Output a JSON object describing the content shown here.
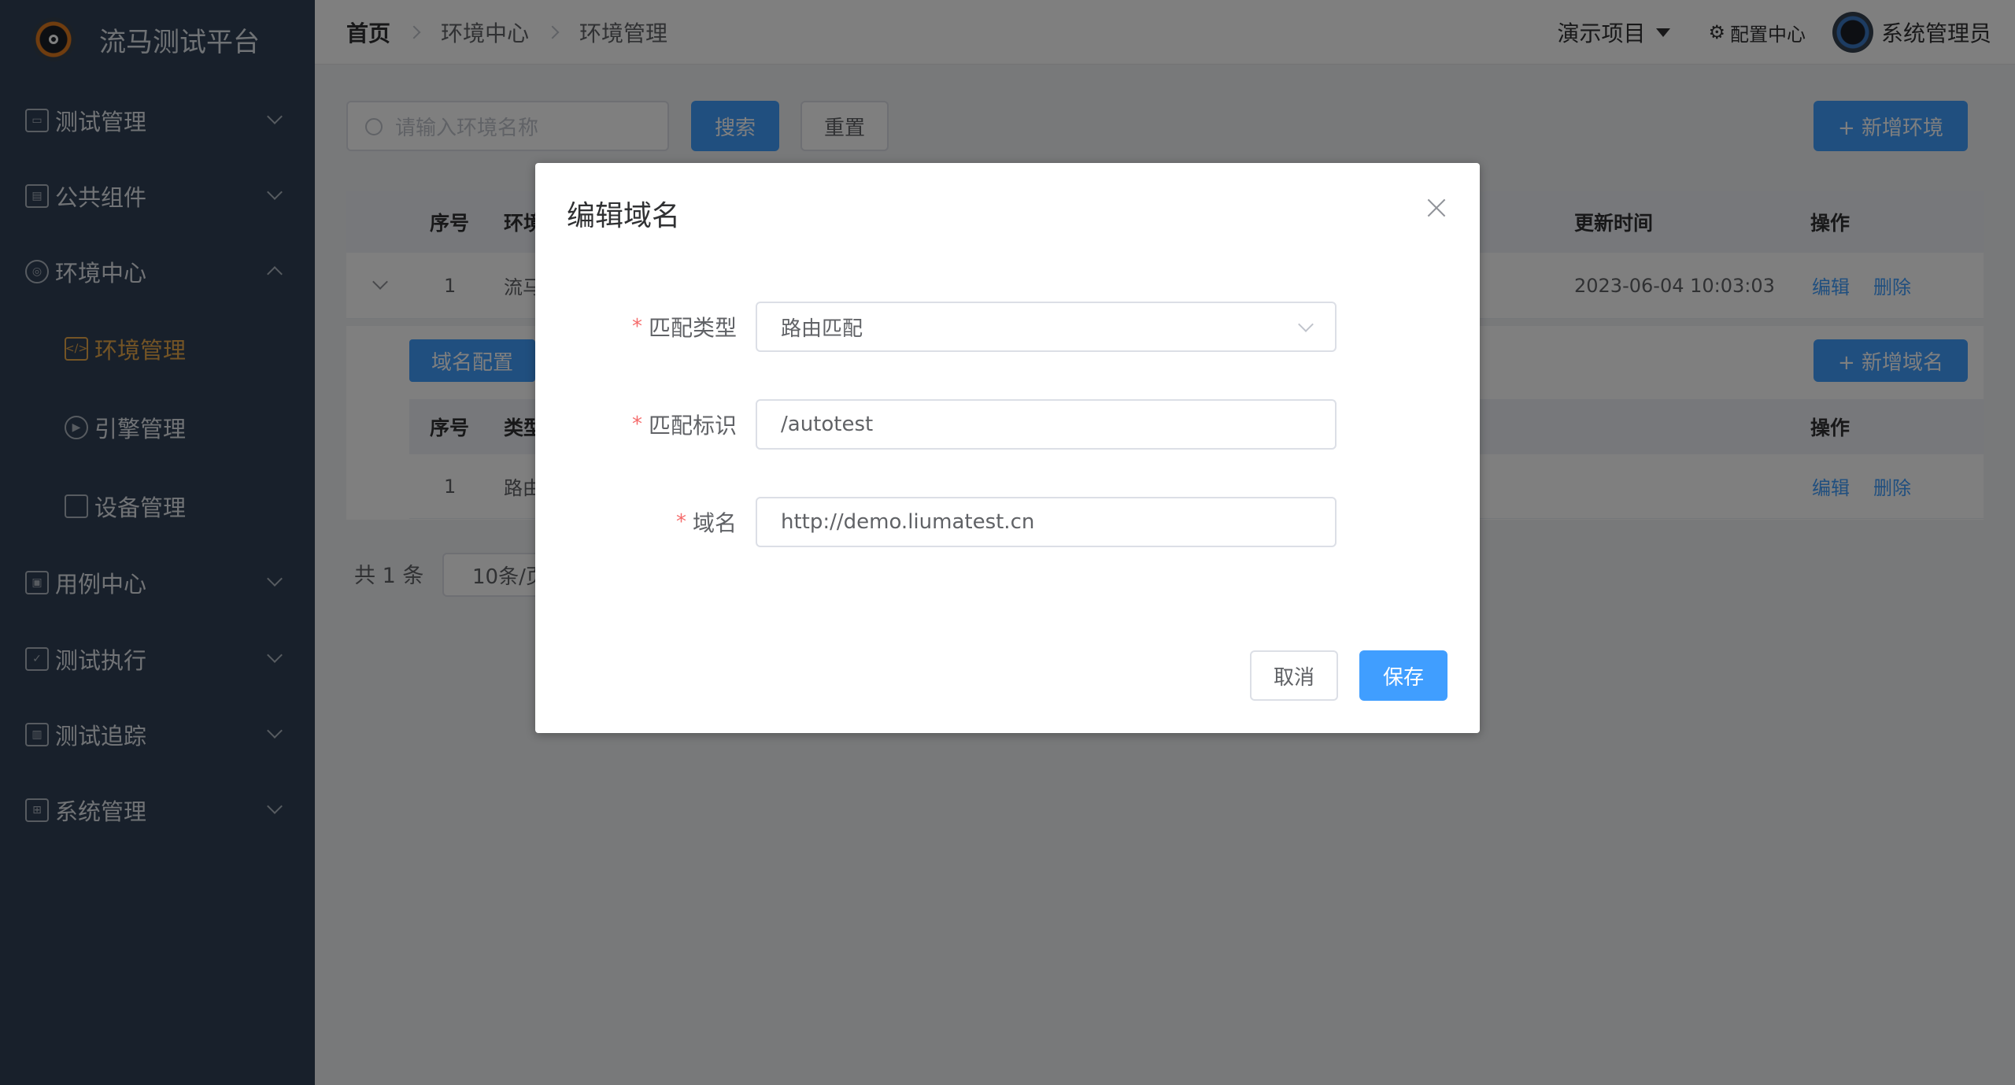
{
  "app": {
    "title": "流马测试平台"
  },
  "sidebar": {
    "items": [
      {
        "label": "测试管理"
      },
      {
        "label": "公共组件"
      },
      {
        "label": "环境中心"
      },
      {
        "label": "环境管理"
      },
      {
        "label": "引擎管理"
      },
      {
        "label": "设备管理"
      },
      {
        "label": "用例中心"
      },
      {
        "label": "测试执行"
      },
      {
        "label": "测试追踪"
      },
      {
        "label": "系统管理"
      }
    ]
  },
  "header": {
    "breadcrumbs": [
      "首页",
      "环境中心",
      "环境管理"
    ],
    "project": "演示项目",
    "config": "配置中心",
    "user": "系统管理员"
  },
  "toolbar": {
    "search_placeholder": "请输入环境名称",
    "search_label": "搜索",
    "reset_label": "重置",
    "add_env_label": "+ 新增环境"
  },
  "env_table": {
    "headers": {
      "index": "序号",
      "name": "环境",
      "updated": "更新时间",
      "actions": "操作"
    },
    "rows": [
      {
        "index": "1",
        "name": "流马",
        "updated": "2023-06-04 10:03:03",
        "edit": "编辑",
        "delete": "删除"
      }
    ]
  },
  "domain_panel": {
    "tab_label": "域名配置",
    "add_domain_label": "+ 新增域名",
    "headers": {
      "index": "序号",
      "type": "类型",
      "actions": "操作"
    },
    "rows": [
      {
        "index": "1",
        "type": "路由",
        "edit": "编辑",
        "delete": "删除"
      }
    ]
  },
  "pagination": {
    "total": "共 1 条",
    "size": "10条/页"
  },
  "modal": {
    "title": "编辑域名",
    "fields": {
      "match_type": {
        "label": "匹配类型",
        "value": "路由匹配"
      },
      "match_key": {
        "label": "匹配标识",
        "value": "/autotest"
      },
      "domain": {
        "label": "域名",
        "value": "http://demo.liumatest.cn"
      }
    },
    "cancel_label": "取消",
    "save_label": "保存"
  },
  "colors": {
    "primary": "#409eff",
    "sidebar": "#304156",
    "active": "#e8a84a",
    "required": "#f56c6c"
  }
}
